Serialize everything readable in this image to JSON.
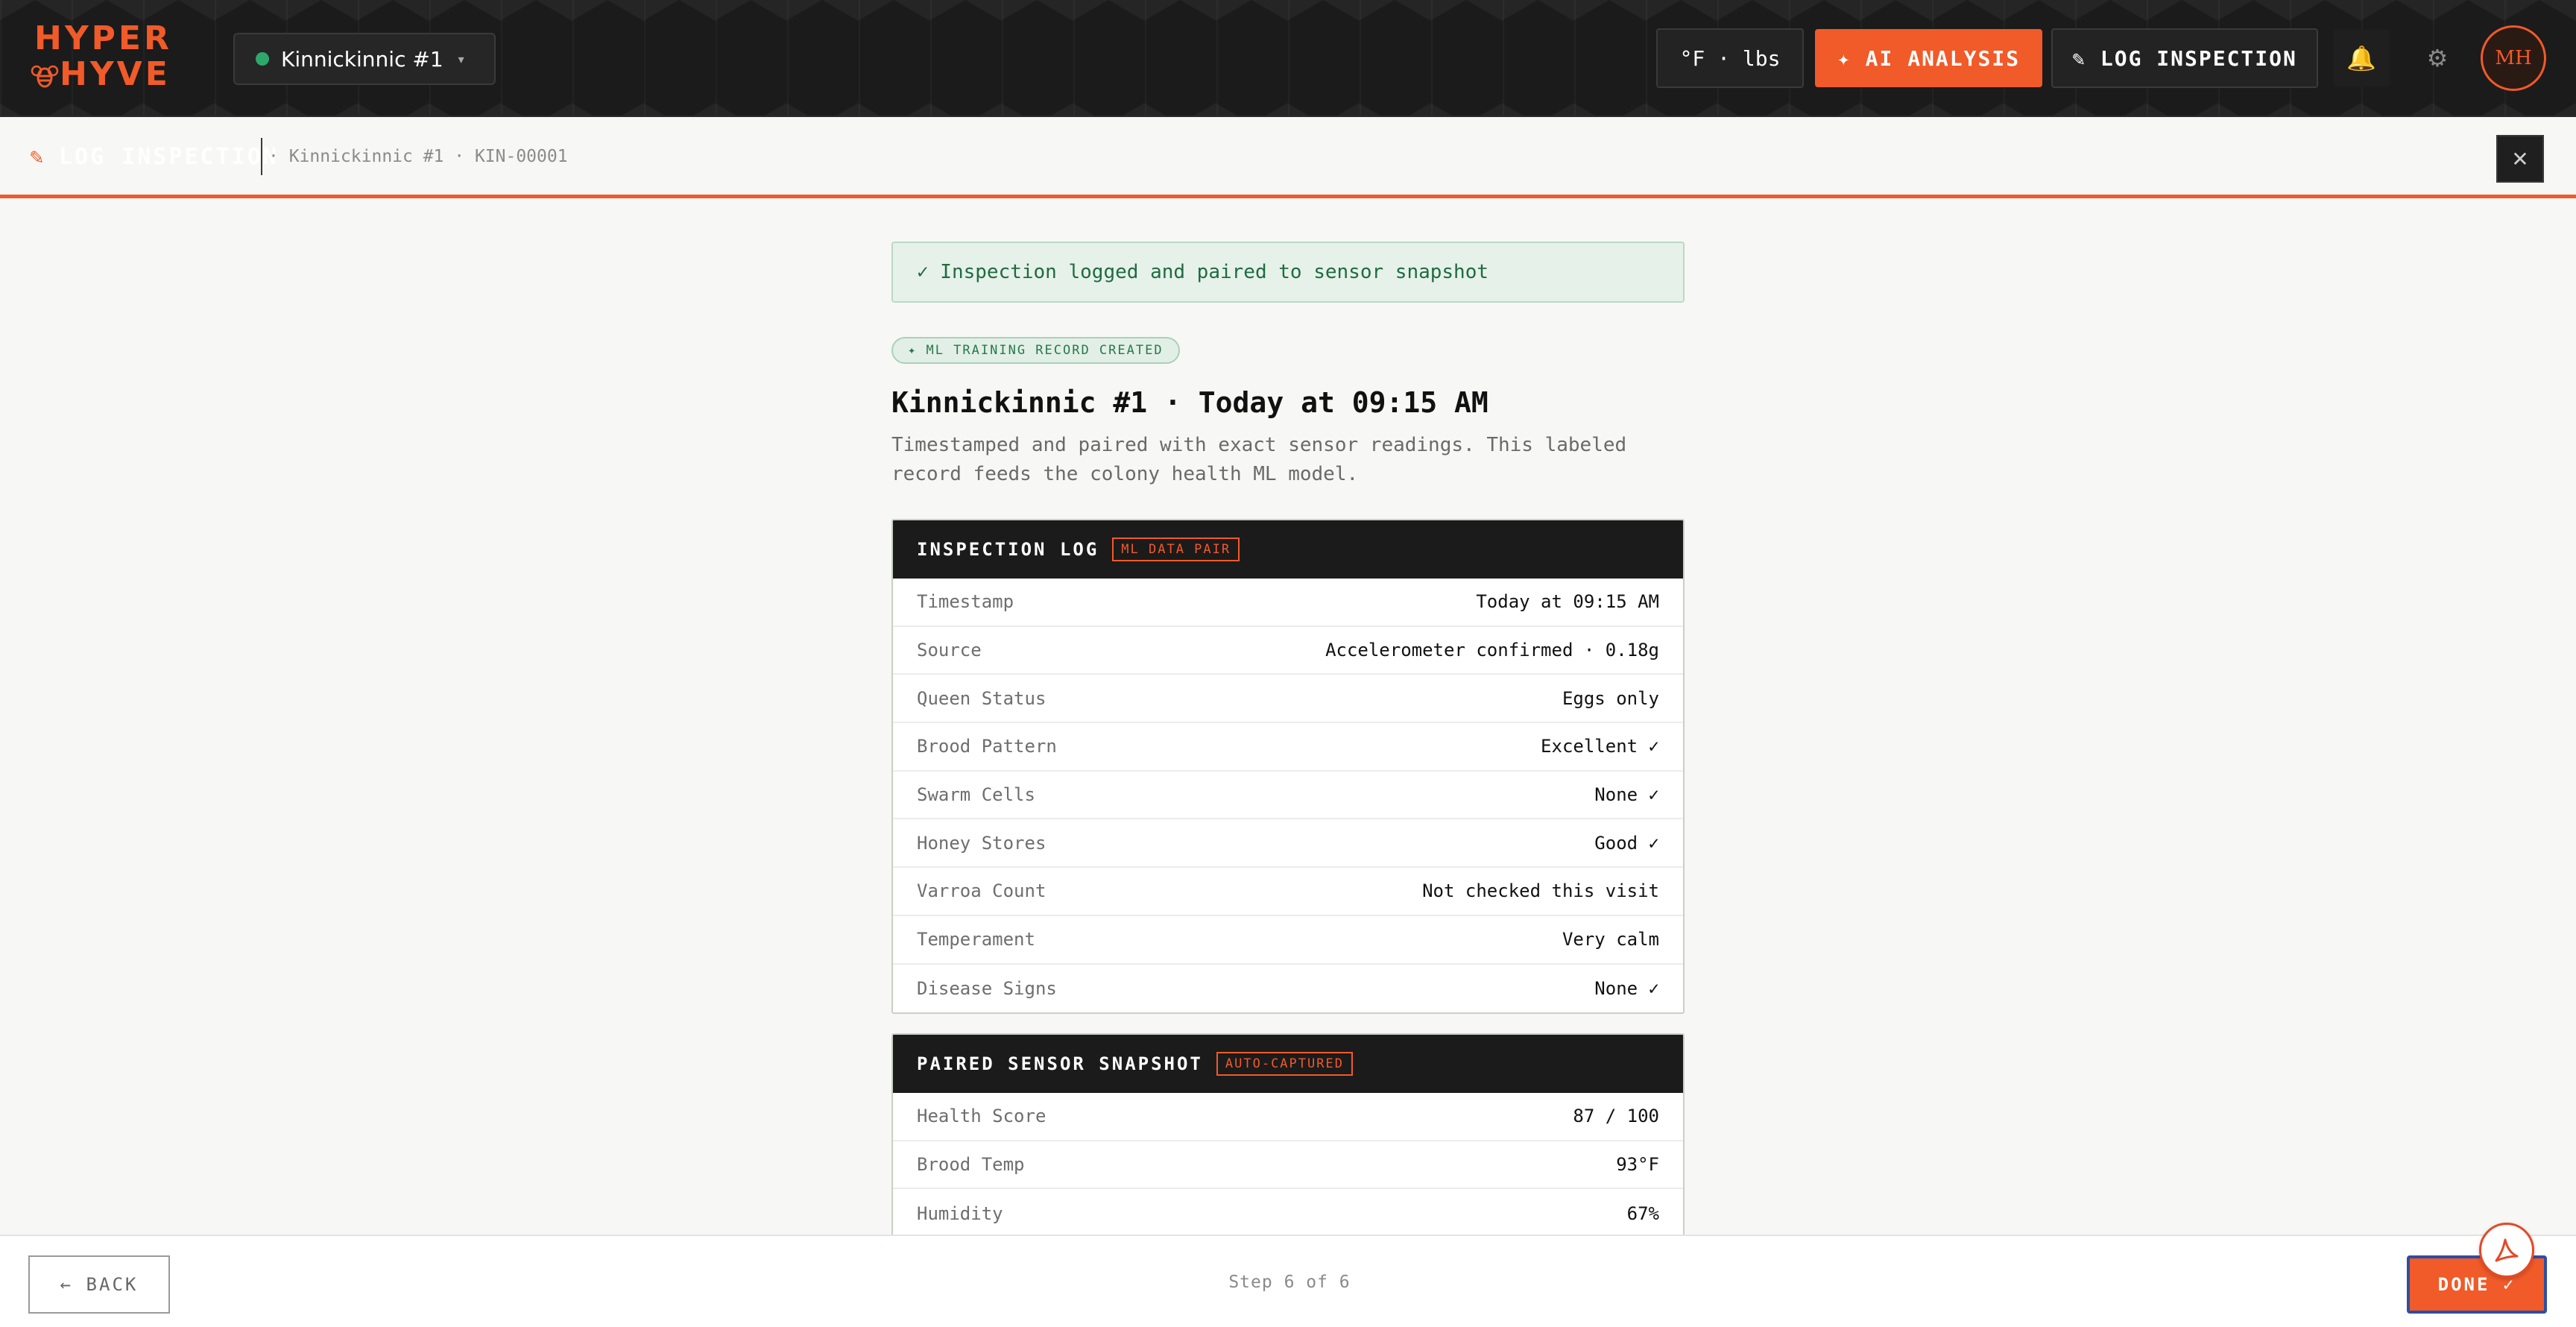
{
  "brand": {
    "line1": "HYPER",
    "line2": "HYVE"
  },
  "hive_selector": {
    "label": "Kinnickinnic #1"
  },
  "header": {
    "units": "°F · lbs",
    "ai_button": "✦ AI ANALYSIS",
    "log_button": "✎ LOG INSPECTION",
    "avatar_initials": "MH"
  },
  "subheader": {
    "title": "LOG INSPECTION",
    "breadcrumb": "· Kinnickinnic #1 · KIN-00001"
  },
  "success": {
    "message": "✓ Inspection logged and paired to sensor snapshot"
  },
  "ml_badge": "✦ ML TRAINING RECORD CREATED",
  "heading": "Kinnickinnic #1 · Today at 09:15 AM",
  "description": "Timestamped and paired with exact sensor readings. This labeled record feeds the colony health ML model.",
  "inspection_log": {
    "title": "INSPECTION LOG",
    "tag": "ML DATA PAIR",
    "rows": [
      {
        "k": "Timestamp",
        "v": "Today at 09:15 AM"
      },
      {
        "k": "Source",
        "v": "Accelerometer confirmed · 0.18g"
      },
      {
        "k": "Queen Status",
        "v": "Eggs only"
      },
      {
        "k": "Brood Pattern",
        "v": "Excellent ✓"
      },
      {
        "k": "Swarm Cells",
        "v": "None ✓"
      },
      {
        "k": "Honey Stores",
        "v": "Good ✓"
      },
      {
        "k": "Varroa Count",
        "v": "Not checked this visit"
      },
      {
        "k": "Temperament",
        "v": "Very calm"
      },
      {
        "k": "Disease Signs",
        "v": "None ✓"
      }
    ]
  },
  "sensor_snapshot": {
    "title": "PAIRED SENSOR SNAPSHOT",
    "tag": "AUTO-CAPTURED",
    "rows": [
      {
        "k": "Health Score",
        "v": "87 / 100"
      },
      {
        "k": "Brood Temp",
        "v": "93°F"
      },
      {
        "k": "Humidity",
        "v": "67%"
      }
    ]
  },
  "footer": {
    "back": "← BACK",
    "step": "Step 6 of 6",
    "done": "DONE ✓"
  },
  "colors": {
    "accent": "#f15a29",
    "dark": "#1b1b1b",
    "success": "#1f6b3f"
  },
  "icons": [
    "bee-icon",
    "bell-icon",
    "gear-icon",
    "close-icon",
    "pdf-icon",
    "chevron-down-icon"
  ]
}
